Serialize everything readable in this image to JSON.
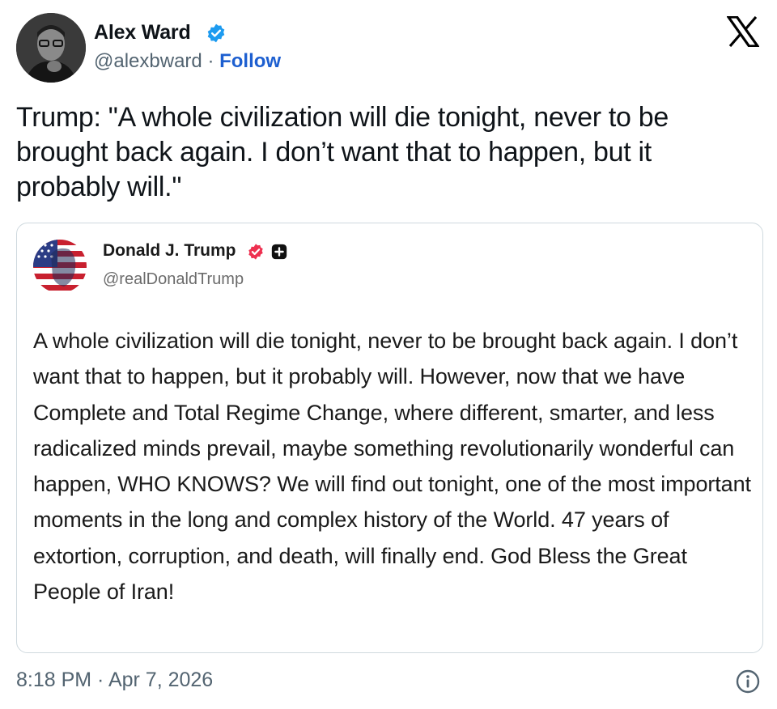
{
  "author": {
    "name": "Alex Ward",
    "handle": "@alexbward",
    "separator": "·",
    "follow_label": "Follow",
    "avatar_icon": "user-avatar-photo",
    "verified_icon": "verified-badge-icon",
    "verified_color": "#1d9bf0"
  },
  "brand": {
    "icon": "x-logo-icon"
  },
  "tweet": {
    "text": "Trump: \"A whole civilization will die tonight, never to be brought back again. I don’t want that to happen, but it probably will.\""
  },
  "quoted": {
    "name": "Donald J. Trump",
    "handle": "@realDonaldTrump",
    "avatar_icon": "flag-portrait-avatar",
    "badge_icons": [
      "red-verified-badge-icon",
      "plus-badge-icon"
    ],
    "badge_red_color": "#ee3050",
    "body": "A whole civilization will die tonight, never to be brought back again. I don’t want that to happen, but it probably will. However, now that we have Complete and Total Regime Change, where different, smarter, and less radicalized minds prevail, maybe something revolutionarily wonderful can happen, WHO KNOWS? We will find out tonight, one of the most important moments in the long and complex history of the World. 47 years of extortion, corruption, and death, will finally end. God Bless the Great People of Iran!"
  },
  "footer": {
    "timestamp": "8:18 PM · Apr 7, 2026",
    "info_icon": "info-icon"
  },
  "colors": {
    "link": "#1d5fd0",
    "secondary_text": "#536471",
    "border": "#cfd9de"
  }
}
